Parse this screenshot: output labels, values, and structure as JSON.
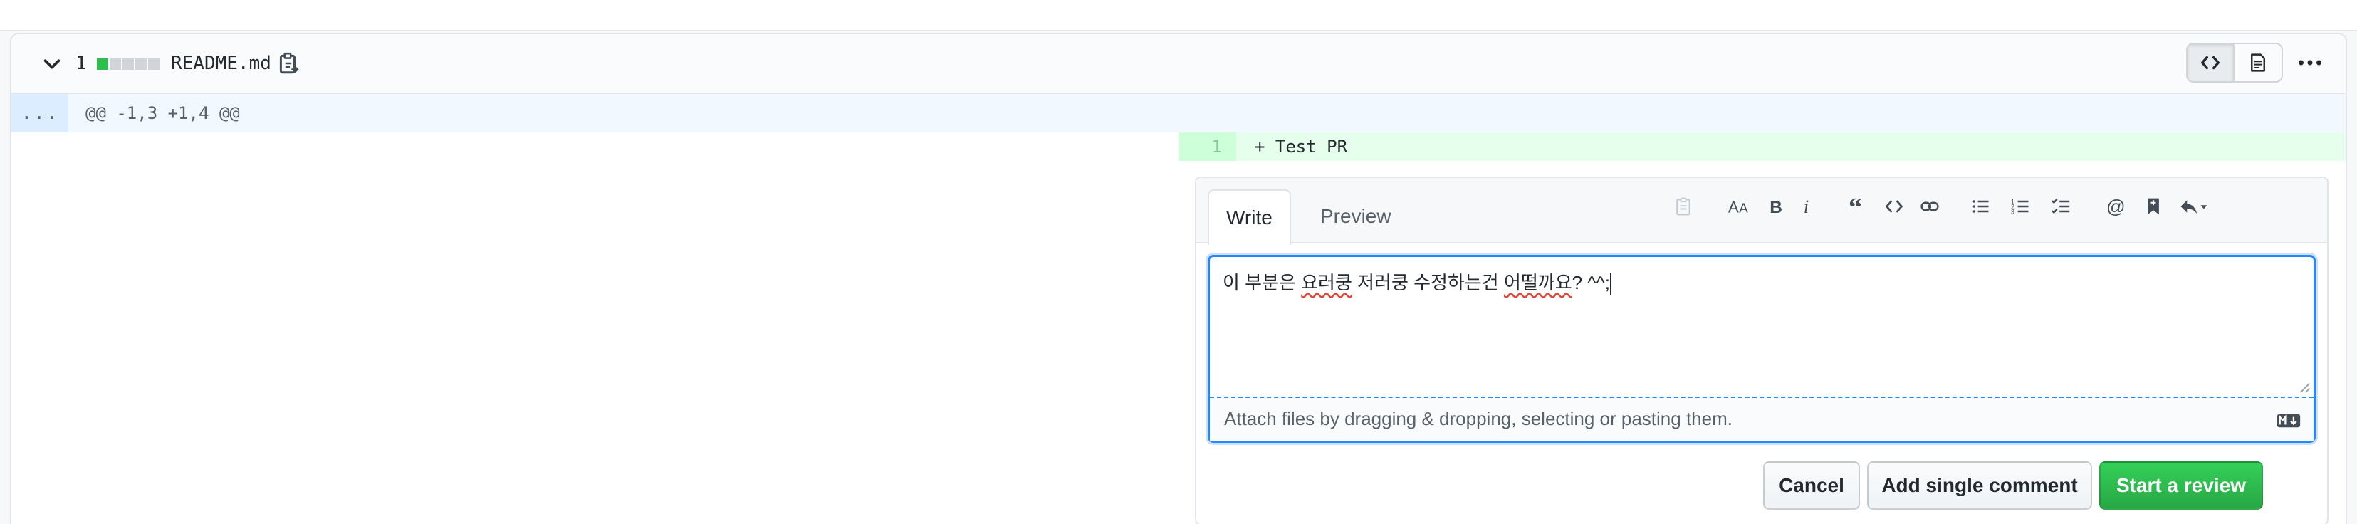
{
  "file": {
    "changes_count": "1",
    "name": "README.md",
    "diffstat": [
      "added",
      "neutral",
      "neutral",
      "neutral",
      "neutral"
    ],
    "colors": {
      "added": "#2cbe4e",
      "neutral": "#d1d5da"
    }
  },
  "hunk": {
    "expand_label": "...",
    "header": "@@ -1,3 +1,4 @@"
  },
  "added_line": {
    "number": "1",
    "code": "+ Test PR"
  },
  "comment_form": {
    "tabs": {
      "write": "Write",
      "preview": "Preview"
    },
    "toolbar_icons": [
      "suggestion-icon",
      "heading-icon",
      "bold-icon",
      "italic-icon",
      "quote-icon",
      "code-icon",
      "link-icon",
      "unordered-list-icon",
      "ordered-list-icon",
      "task-list-icon",
      "mention-icon",
      "saved-reply-icon",
      "reply-icon"
    ],
    "text_before": "이 부분은 ",
    "text_misspelled_1": "요러쿵",
    "text_middle": " 저러쿵 수정하는건 ",
    "text_misspelled_2": "어떨까요",
    "text_after": "? ^^;",
    "attach_hint": "Attach files by dragging & dropping, selecting or pasting them."
  },
  "buttons": {
    "cancel": "Cancel",
    "add_single": "Add single comment",
    "start_review": "Start a review"
  },
  "theme": {
    "accent_blue": "#2188ff",
    "primary_green": "#28a745",
    "added_bg": "#e6ffed",
    "hunk_bg": "#f1f8ff"
  }
}
